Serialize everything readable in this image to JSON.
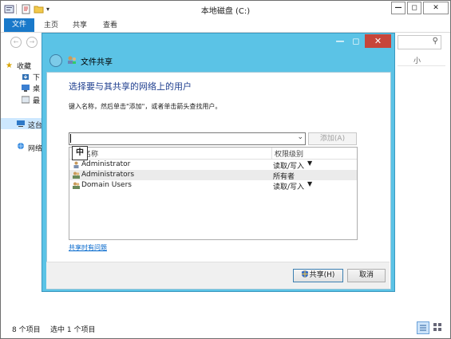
{
  "explorer": {
    "title": "本地磁盘 (C:)",
    "window_controls": [
      "—",
      "◻",
      "✕"
    ],
    "ribbon_tabs": [
      {
        "label": "文件",
        "selected": true
      },
      {
        "label": "主页"
      },
      {
        "label": "共享"
      },
      {
        "label": "查看"
      }
    ],
    "nav_items": [
      "收藏",
      "下",
      "桌",
      "最",
      "这台",
      "网络"
    ],
    "partial_right_label": "小",
    "status": {
      "item_count": "8 个项目",
      "selected": "选中 1 个项目"
    }
  },
  "dialog": {
    "title": "文件共享",
    "heading": "选择要与其共享的网络上的用户",
    "instruction": "键入名称，然后单击\"添加\"，或者单击箭头查找用户。",
    "name_input": {
      "value": ""
    },
    "add_button": "添加(A)",
    "ime_indicator": "中",
    "columns": {
      "name": "名称",
      "permission": "权限级别"
    },
    "users": [
      {
        "name": "Administrator",
        "permission": "读取/写入",
        "has_dropdown": true
      },
      {
        "name": "Administrators",
        "permission": "所有者",
        "has_dropdown": false,
        "highlighted": true
      },
      {
        "name": "Domain Users",
        "permission": "读取/写入",
        "has_dropdown": true
      }
    ],
    "help_link": "共享时有问题",
    "share_button": "共享(H)",
    "cancel_button": "取消",
    "window_controls": [
      "—",
      "◻",
      "✕"
    ]
  },
  "colors": {
    "dialog_frame": "#5bc3e6",
    "heading": "#1f3f8f",
    "link": "#0066cc",
    "ribbon_file": "#1979ca",
    "close_red": "#c7453a"
  }
}
